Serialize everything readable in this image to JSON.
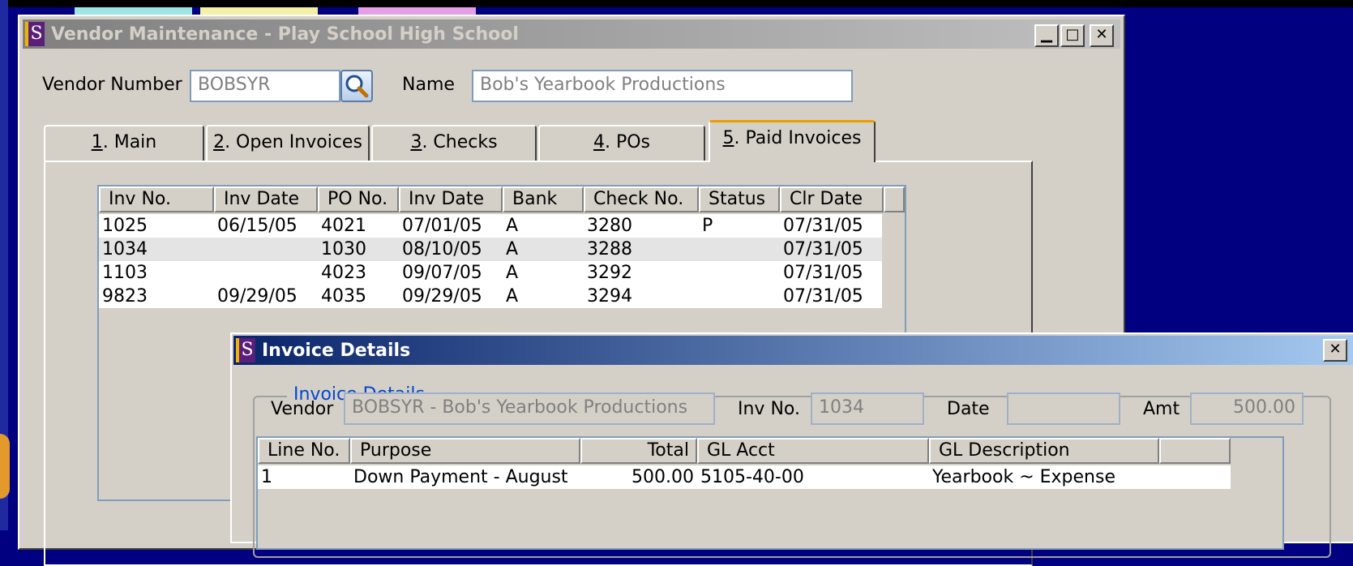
{
  "vendor_window": {
    "title": "Vendor Maintenance - Play School High School",
    "icon_letter": "S",
    "vendor_number_label": "Vendor Number",
    "vendor_number_value": "BOBSYR",
    "name_label": "Name",
    "name_value": "Bob's Yearbook Productions",
    "tabs": [
      {
        "key": "1",
        "label": ". Main"
      },
      {
        "key": "2",
        "label": ". Open Invoices"
      },
      {
        "key": "3",
        "label": ". Checks"
      },
      {
        "key": "4",
        "label": ". POs"
      },
      {
        "key": "5",
        "label": ". Paid Invoices"
      }
    ],
    "selected_tab": 4,
    "grid": {
      "columns": [
        "Inv No.",
        "Inv Date",
        "PO No.",
        "Inv Date",
        "Bank",
        "Check No.",
        "Status",
        "Clr Date"
      ],
      "rows": [
        [
          "1025",
          "06/15/05",
          "4021",
          "07/01/05",
          "A",
          "3280",
          "P",
          "07/31/05"
        ],
        [
          "1034",
          "",
          "1030",
          "08/10/05",
          "A",
          "3288",
          "",
          "07/31/05"
        ],
        [
          "1103",
          "",
          "4023",
          "09/07/05",
          "A",
          "3292",
          "",
          "07/31/05"
        ],
        [
          "9823",
          "09/29/05",
          "4035",
          "09/29/05",
          "A",
          "3294",
          "",
          "07/31/05"
        ]
      ]
    }
  },
  "invoice_dialog": {
    "title": "Invoice Details",
    "icon_letter": "S",
    "group_title": "Invoice Details",
    "vendor_label": "Vendor",
    "vendor_value": "BOBSYR - Bob's Yearbook Productions",
    "inv_no_label": "Inv No.",
    "inv_no_value": "1034",
    "date_label": "Date",
    "date_value": "",
    "amt_label": "Amt",
    "amt_value": "500.00",
    "lines": {
      "columns": [
        "Line No.",
        "Purpose",
        "Total",
        "GL Acct",
        "GL Description"
      ],
      "rows": [
        [
          "1",
          "Down Payment - August",
          "500.00",
          "5105-40-00",
          "Yearbook ~ Expense"
        ]
      ]
    }
  }
}
